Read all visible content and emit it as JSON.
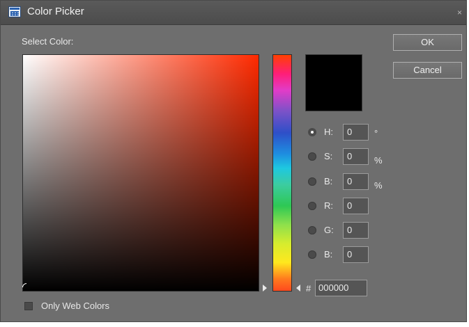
{
  "window": {
    "title": "Color Picker",
    "close_glyph": "×"
  },
  "picker": {
    "label": "Select Color:"
  },
  "buttons": {
    "ok": "OK",
    "cancel": "Cancel"
  },
  "fields": [
    {
      "label": "H:",
      "value": "0",
      "unit": "°",
      "selected": true
    },
    {
      "label": "S:",
      "value": "0",
      "unit": "%",
      "selected": false
    },
    {
      "label": "B:",
      "value": "0",
      "unit": "%",
      "selected": false
    },
    {
      "label": "R:",
      "value": "0",
      "unit": "",
      "selected": false
    },
    {
      "label": "G:",
      "value": "0",
      "unit": "",
      "selected": false
    },
    {
      "label": "B:",
      "value": "0",
      "unit": "",
      "selected": false
    }
  ],
  "hex": {
    "prefix": "#",
    "value": "000000"
  },
  "web_colors": {
    "label": "Only Web Colors",
    "checked": false
  },
  "colors": {
    "selected_swatch": "#000000",
    "dialog_bg": "#6e6e6e",
    "hue_base": "#ff2a00"
  }
}
